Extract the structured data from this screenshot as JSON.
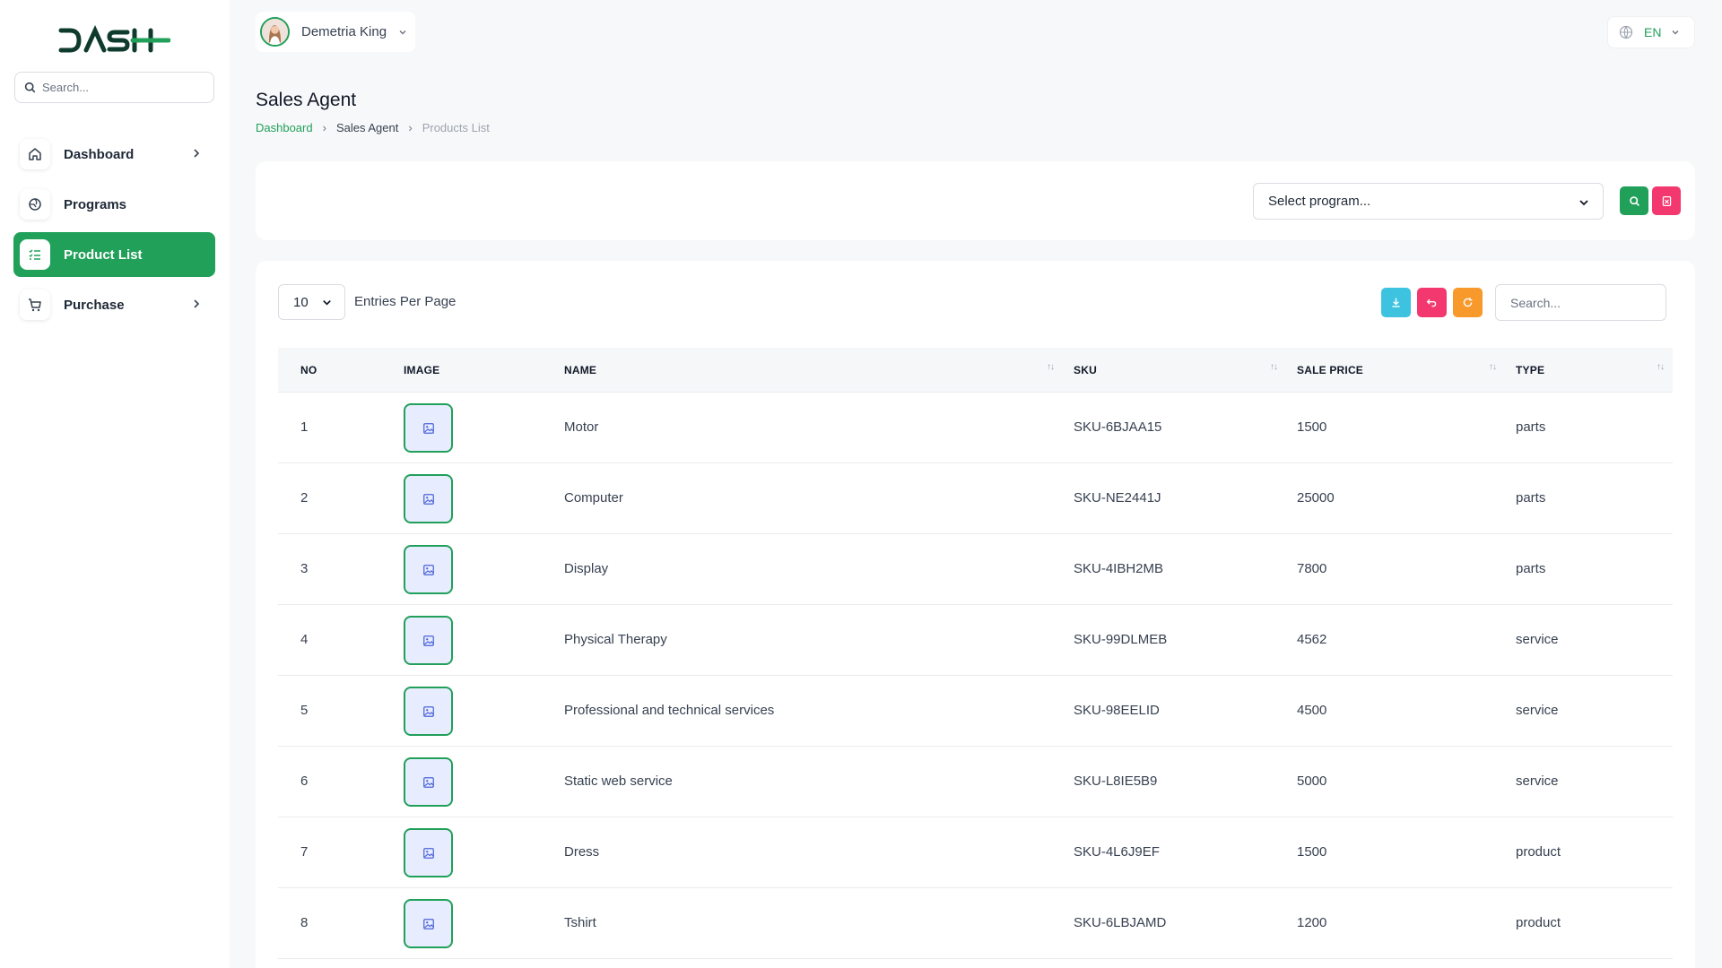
{
  "sidebar": {
    "search_placeholder": "Search...",
    "items": [
      {
        "label": "Dashboard",
        "icon": "home-icon",
        "has_chevron": true
      },
      {
        "label": "Programs",
        "icon": "globe-icon",
        "has_chevron": false
      },
      {
        "label": "Product List",
        "icon": "list-icon",
        "has_chevron": false,
        "active": true
      },
      {
        "label": "Purchase",
        "icon": "cart-icon",
        "has_chevron": true
      }
    ]
  },
  "header": {
    "user_name": "Demetria King",
    "language": "EN"
  },
  "page": {
    "title": "Sales Agent",
    "breadcrumb": [
      "Dashboard",
      "Sales Agent",
      "Products List"
    ]
  },
  "filter": {
    "program_placeholder": "Select program..."
  },
  "table": {
    "entries_value": "10",
    "entries_label": "Entries Per Page",
    "search_placeholder": "Search...",
    "columns": [
      "NO",
      "IMAGE",
      "NAME",
      "SKU",
      "SALE PRICE",
      "TYPE"
    ],
    "rows": [
      {
        "no": "1",
        "name": "Motor",
        "sku": "SKU-6BJAA15",
        "price": "1500",
        "type": "parts"
      },
      {
        "no": "2",
        "name": "Computer",
        "sku": "SKU-NE2441J",
        "price": "25000",
        "type": "parts"
      },
      {
        "no": "3",
        "name": "Display",
        "sku": "SKU-4IBH2MB",
        "price": "7800",
        "type": "parts"
      },
      {
        "no": "4",
        "name": "Physical Therapy",
        "sku": "SKU-99DLMEB",
        "price": "4562",
        "type": "service"
      },
      {
        "no": "5",
        "name": "Professional and technical services",
        "sku": "SKU-98EELID",
        "price": "4500",
        "type": "service"
      },
      {
        "no": "6",
        "name": "Static web service",
        "sku": "SKU-L8IE5B9",
        "price": "5000",
        "type": "service"
      },
      {
        "no": "7",
        "name": "Dress",
        "sku": "SKU-4L6J9EF",
        "price": "1500",
        "type": "product"
      },
      {
        "no": "8",
        "name": "Tshirt",
        "sku": "SKU-6LBJAMD",
        "price": "1200",
        "type": "product"
      }
    ]
  },
  "colors": {
    "accent": "#21a05a",
    "download": "#3dc3e0",
    "undo": "#f2386f",
    "refresh": "#f79a2b",
    "thumb_bg": "#e8ecff"
  }
}
